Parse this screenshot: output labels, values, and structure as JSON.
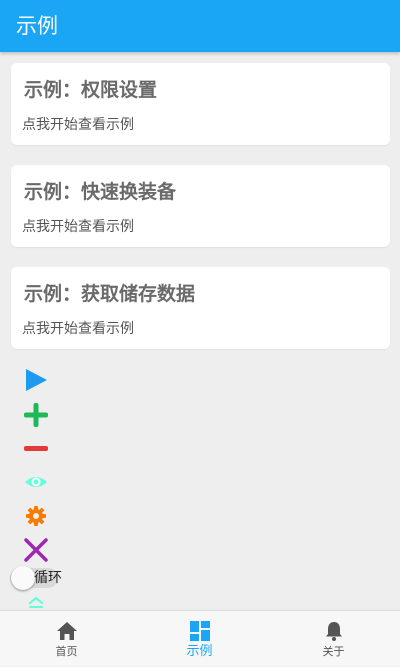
{
  "app_bar": {
    "title": "示例"
  },
  "cards": [
    {
      "title": "示例：权限设置",
      "subtitle": "点我开始查看示例"
    },
    {
      "title": "示例：快速换装备",
      "subtitle": "点我开始查看示例"
    },
    {
      "title": "示例：获取储存数据",
      "subtitle": "点我开始查看示例"
    }
  ],
  "floating_tools": [
    {
      "icon": "play-icon",
      "color": "#1e9bf0"
    },
    {
      "icon": "plus-icon",
      "color": "#1db954"
    },
    {
      "icon": "minus-icon",
      "color": "#e53935"
    },
    {
      "icon": "eye-icon",
      "color": "#64ffda"
    },
    {
      "icon": "gear-icon",
      "color": "#f57c00"
    },
    {
      "icon": "close-icon",
      "color": "#9c27b0"
    },
    {
      "icon": "chevron-up-icon",
      "color": "#64ffda"
    }
  ],
  "loop_toggle": {
    "label": "循环",
    "checked": false
  },
  "bottom_nav": {
    "items": [
      {
        "label": "首页",
        "icon": "home-icon",
        "active": false
      },
      {
        "label": "示例",
        "icon": "dashboard-icon",
        "active": true
      },
      {
        "label": "关于",
        "icon": "bell-icon",
        "active": false
      }
    ]
  },
  "colors": {
    "primary": "#1aa6f5",
    "background": "#eeeeee",
    "card": "#ffffff"
  }
}
